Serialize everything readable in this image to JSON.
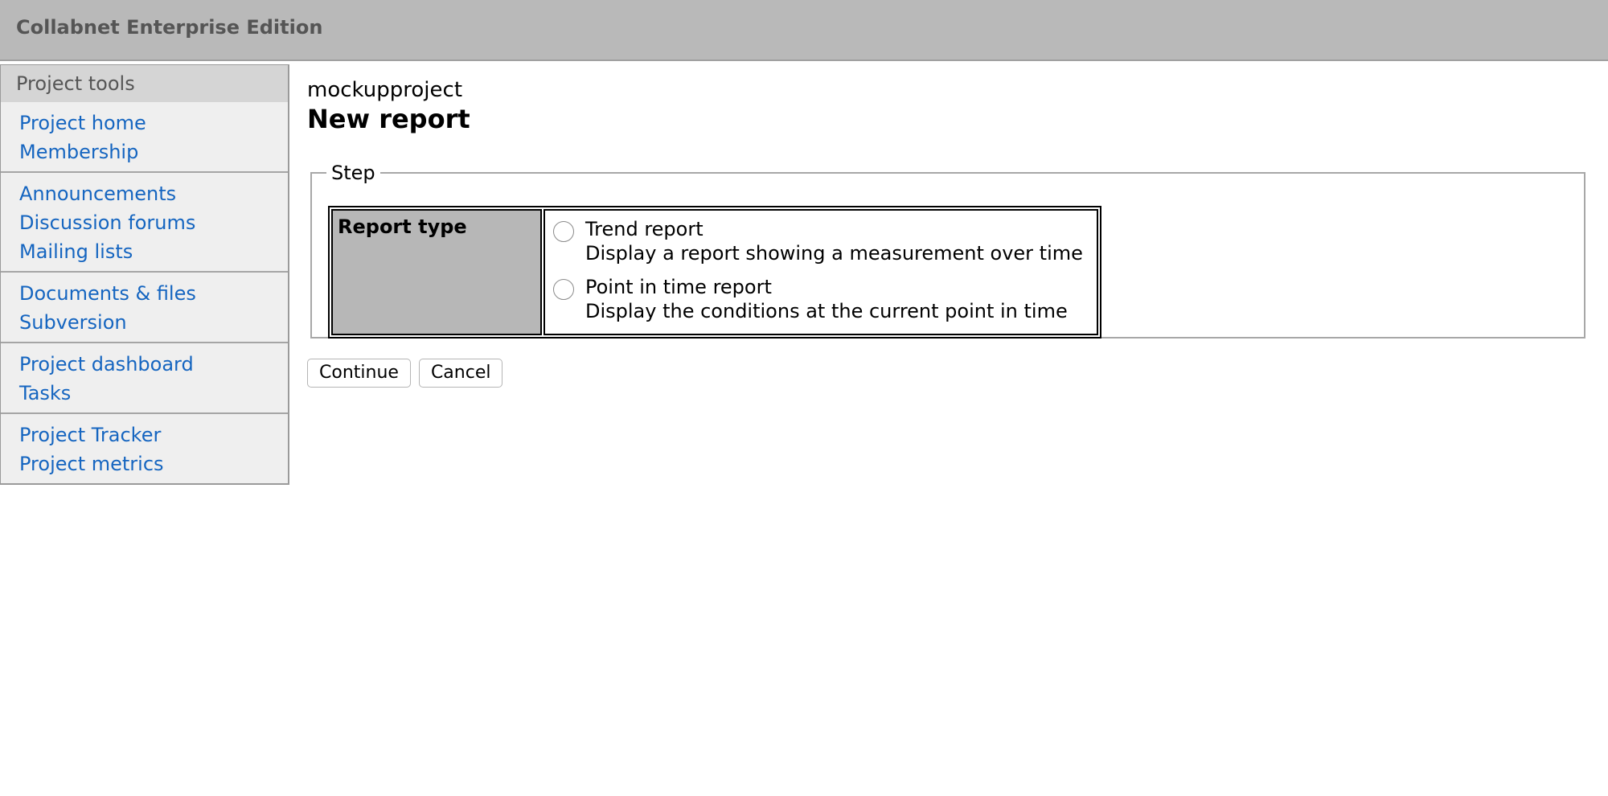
{
  "header": {
    "title": "Collabnet Enterprise Edition"
  },
  "sidebar": {
    "header": "Project tools",
    "groups": [
      [
        "Project home",
        "Membership"
      ],
      [
        "Announcements",
        "Discussion forums",
        "Mailing lists"
      ],
      [
        "Documents & files",
        "Subversion"
      ],
      [
        "Project dashboard",
        "Tasks"
      ],
      [
        "Project Tracker",
        "Project metrics"
      ]
    ]
  },
  "main": {
    "project_name": "mockupproject",
    "title": "New report",
    "fieldset_legend": "Step",
    "report_type_label": "Report type",
    "options": [
      {
        "title": "Trend report",
        "description": "Display a report showing a measurement over time",
        "selected": false
      },
      {
        "title": "Point in time report",
        "description": "Display the conditions at the current point in time",
        "selected": false
      }
    ],
    "buttons": {
      "continue": "Continue",
      "cancel": "Cancel"
    }
  }
}
